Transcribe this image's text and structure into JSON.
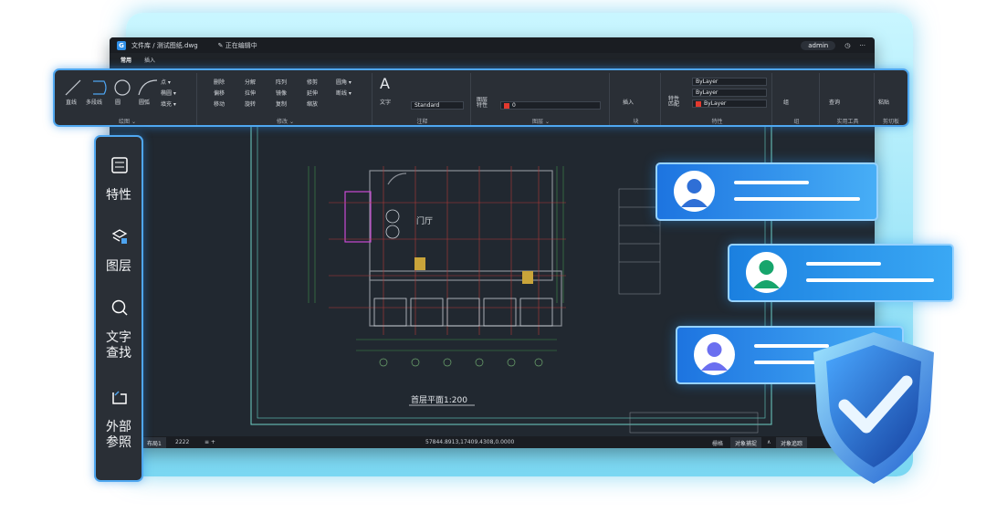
{
  "titlebar": {
    "logo": "G",
    "title": "文件库 / 测试图纸.dwg",
    "edit_status": "✎ 正在编辑中",
    "user": "admin",
    "icon_settings": "◷",
    "icon_more": "···"
  },
  "menubar": {
    "tabs": [
      "常用",
      "插入"
    ]
  },
  "ribbon": {
    "draw": {
      "label": "绘图 ⌄",
      "line": "直线",
      "polyline": "多段线",
      "circle": "圆",
      "arc": "圆弧",
      "point": "点 ▾",
      "ellipse": "椭圆 ▾",
      "fill": "填充 ▾"
    },
    "modify": {
      "label": "修改 ⌄",
      "r1": [
        "删除",
        "分解",
        "阵列",
        "修剪",
        "圆角 ▾"
      ],
      "r2": [
        "偏移",
        "拉伸",
        "镜像",
        "延伸",
        "断线 ▾"
      ],
      "r3": [
        "移动",
        "旋转",
        "复制",
        "缩放"
      ]
    },
    "annotate": {
      "label": "注释",
      "text": "文字",
      "style": "Standard"
    },
    "layer": {
      "label": "图层 ⌄",
      "props": "图层\n特性",
      "current": "0"
    },
    "block": {
      "label": "块",
      "insert": "插入"
    },
    "properties": {
      "label": "特性",
      "match": "特性\n匹配",
      "linetype1": "ByLayer",
      "linetype2": "ByLayer",
      "color": "ByLayer",
      "color_hex": "#e2392e"
    },
    "group": {
      "label": "组",
      "group": "组"
    },
    "utilities": {
      "label": "实用工具",
      "query": "查询"
    },
    "clipboard": {
      "label": "剪切板",
      "paste": "粘贴"
    }
  },
  "drawing": {
    "title": "首层平面1:200",
    "room": "门厅"
  },
  "statusbar": {
    "layout": "布局1",
    "number": "2222",
    "menu": "≡ +",
    "coords": "57844.8913,17409.4308,0.0000",
    "grid": "栅格",
    "snap": "对象捕捉",
    "snap_arrow": "∧",
    "track": "对象追踪"
  },
  "sidepanel": {
    "items": [
      {
        "label": "特性"
      },
      {
        "label": "图层"
      },
      {
        "label": "文字\n查找"
      },
      {
        "label": "外部\n参照"
      }
    ]
  },
  "colors": {
    "accent": "#4fa7f0",
    "canvas": "#212830",
    "card_gradient_start": "#1d74e0",
    "card_gradient_end": "#47aef6",
    "avatar_blue": "#2f6fd6",
    "avatar_green": "#17a56c",
    "shield": "#2b6fd8"
  }
}
